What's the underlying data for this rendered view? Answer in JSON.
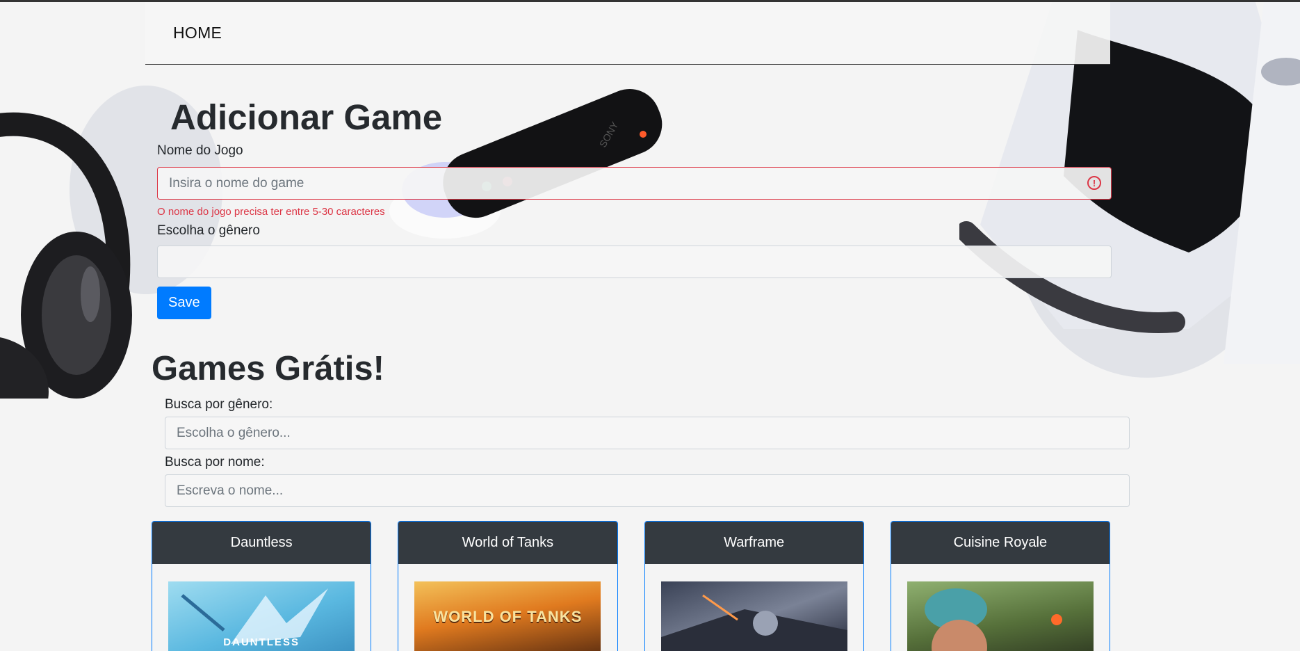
{
  "nav": {
    "home_label": "HOME"
  },
  "add_game": {
    "title": "Adicionar Game",
    "name_label": "Nome do Jogo",
    "name_placeholder": "Insira o nome do game",
    "name_value": "",
    "name_error": "O nome do jogo precisa ter entre 5-30 caracteres",
    "genre_label": "Escolha o gênero",
    "genre_value": "",
    "save_label": "Save"
  },
  "free_games": {
    "title": "Games Grátis!",
    "genre_search_label": "Busca por gênero:",
    "genre_search_placeholder": "Escolha o gênero...",
    "name_search_label": "Busca por nome:",
    "name_search_placeholder": "Escreva o nome...",
    "cards": [
      {
        "title": "Dauntless",
        "image_text": "DAUNTLESS"
      },
      {
        "title": "World of Tanks",
        "image_text": "WORLD OF TANKS"
      },
      {
        "title": "Warframe"
      },
      {
        "title": "Cuisine Royale"
      }
    ]
  },
  "colors": {
    "primary": "#007bff",
    "danger": "#dc3545",
    "card_header": "#343a40",
    "background": "#f4f4f4"
  }
}
